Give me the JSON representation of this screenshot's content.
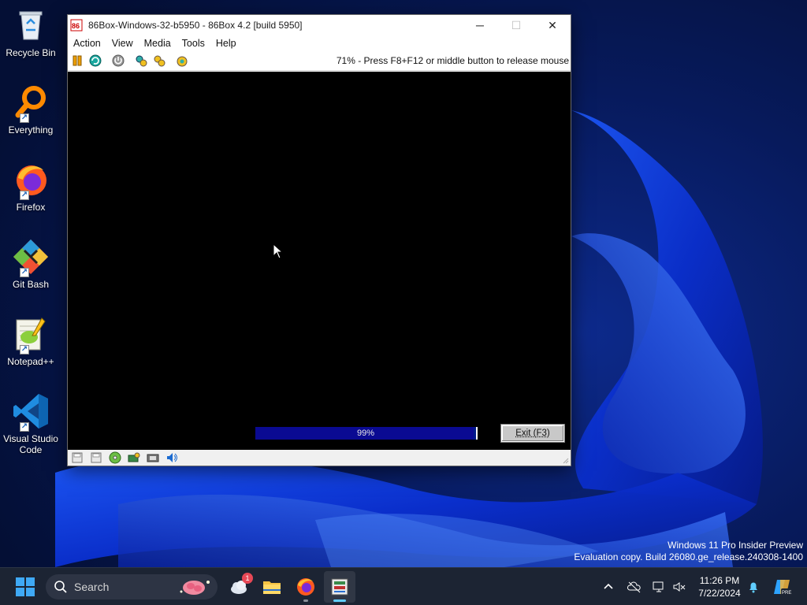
{
  "desktop": {
    "icons": [
      {
        "label": "Recycle Bin"
      },
      {
        "label": "Everything"
      },
      {
        "label": "Firefox"
      },
      {
        "label": "Git Bash"
      },
      {
        "label": "Notepad++"
      },
      {
        "label": "Visual Studio Code"
      }
    ]
  },
  "window": {
    "title": "86Box-Windows-32-b5950 - 86Box 4.2 [build 5950]",
    "caption": {
      "minimize": "─",
      "maximize": "☐",
      "close": "✕"
    },
    "menu": [
      "Action",
      "View",
      "Media",
      "Tools",
      "Help"
    ],
    "toolbar_status": "71% - Press F8+F12 or middle button to release mouse",
    "toolbar_icons": [
      "pause-icon",
      "ctrl-alt-del-icon",
      "power-icon",
      "settings-icon",
      "hard-reset-icon",
      "screenshot-icon"
    ],
    "progress": {
      "value": 0.99,
      "label": "99%"
    },
    "exit_button": "Exit (F3)",
    "status_icons": [
      "floppy-a-icon",
      "floppy-b-icon",
      "cdrom-icon",
      "hard-disk-icon",
      "network-icon",
      "sound-icon"
    ]
  },
  "watermark": {
    "line1": "Windows 11 Pro Insider Preview",
    "line2": "Evaluation copy. Build 26080.ge_release.240308-1400"
  },
  "taskbar": {
    "search_placeholder": "Search",
    "weather_badge": "1",
    "clock_time": "11:26 PM",
    "clock_date": "7/22/2024",
    "copilot_badge": "PRE"
  },
  "colors": {
    "accent": "#60cdff",
    "progress_track": "#001a8a",
    "screen": "#000000",
    "taskbar": "#1c2433"
  }
}
